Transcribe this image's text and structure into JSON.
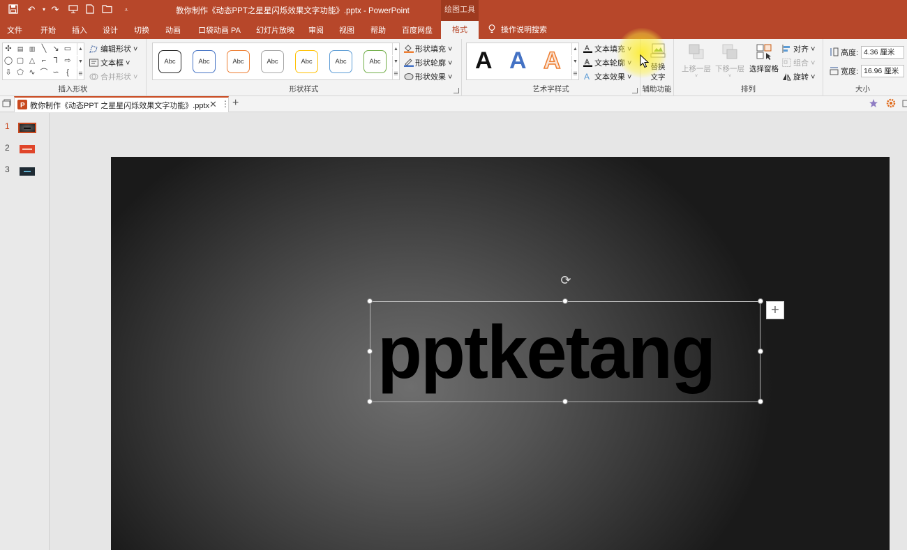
{
  "app": {
    "title": "教你制作《动态PPT之星星闪烁效果文字功能》.pptx  -  PowerPoint",
    "context_group": "绘图工具"
  },
  "tabs": [
    "文件",
    "开始",
    "插入",
    "设计",
    "切换",
    "动画",
    "口袋动画 PA",
    "幻灯片放映",
    "审阅",
    "视图",
    "帮助",
    "百度网盘"
  ],
  "active_tab": "格式",
  "tell_me": "操作说明搜索",
  "ribbon": {
    "insert_shapes": {
      "label": "插入形状",
      "edit_shape": "编辑形状",
      "text_box": "文本框",
      "merge_shapes": "合并形状"
    },
    "shape_styles": {
      "label": "形状样式",
      "preset_text": "Abc",
      "fill": "形状填充",
      "outline": "形状轮廓",
      "effects": "形状效果",
      "preset_colors": [
        "#333333",
        "#4472c4",
        "#ed7d31",
        "#a5a5a5",
        "#ffc000",
        "#5b9bd5",
        "#70ad47"
      ]
    },
    "wordart": {
      "label": "艺术字样式",
      "sample": "A",
      "text_fill": "文本填充",
      "text_outline": "文本轮廓",
      "text_effects": "文本效果"
    },
    "accessibility": {
      "label": "辅助功能",
      "alt_text_line1": "替换",
      "alt_text_line2": "文字"
    },
    "arrange": {
      "label": "排列",
      "bring_forward": "上移一层",
      "send_backward": "下移一层",
      "selection_pane": "选择窗格",
      "align": "对齐",
      "group": "组合",
      "rotate": "旋转"
    },
    "size": {
      "label": "大小",
      "height_label": "高度:",
      "height_value": "4.36 厘米",
      "width_label": "宽度:",
      "width_value": "16.96 厘米"
    }
  },
  "document_tab": {
    "title": "教你制作《动态PPT 之星星闪烁效果文字功能》.pptx"
  },
  "slides": [
    {
      "number": "1",
      "selected": true
    },
    {
      "number": "2",
      "selected": false
    },
    {
      "number": "3",
      "selected": false
    }
  ],
  "slide": {
    "text": "pptketang"
  },
  "colors": {
    "accent": "#b7472a",
    "ribbon_bg": "#f3f3f3"
  }
}
